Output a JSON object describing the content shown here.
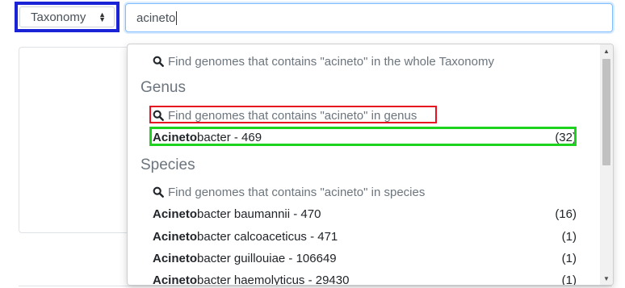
{
  "filter_select": {
    "value": "Taxonomy"
  },
  "search": {
    "value": "acineto"
  },
  "dropdown": {
    "whole_taxonomy_find": "Find genomes that contains \"acineto\" in the whole Taxonomy",
    "genus": {
      "heading": "Genus",
      "find": "Find genomes that contains \"acineto\" in genus",
      "items": [
        {
          "match": "Acineto",
          "rest": "bacter - 469",
          "count": "(32)"
        }
      ]
    },
    "species": {
      "heading": "Species",
      "find": "Find genomes that contains \"acineto\" in species",
      "items": [
        {
          "match": "Acineto",
          "rest": "bacter baumannii - 470",
          "count": "(16)"
        },
        {
          "match": "Acineto",
          "rest": "bacter calcoaceticus - 471",
          "count": "(1)"
        },
        {
          "match": "Acineto",
          "rest": "bacter guillouiae - 106649",
          "count": "(1)"
        },
        {
          "match": "Acineto",
          "rest": "bacter haemolyticus - 29430",
          "count": "(1)"
        }
      ]
    }
  },
  "colors": {
    "select_highlight": "#1a23d6",
    "genus_find_highlight": "#e8111f",
    "genus_item_highlight": "#1ed31e"
  }
}
